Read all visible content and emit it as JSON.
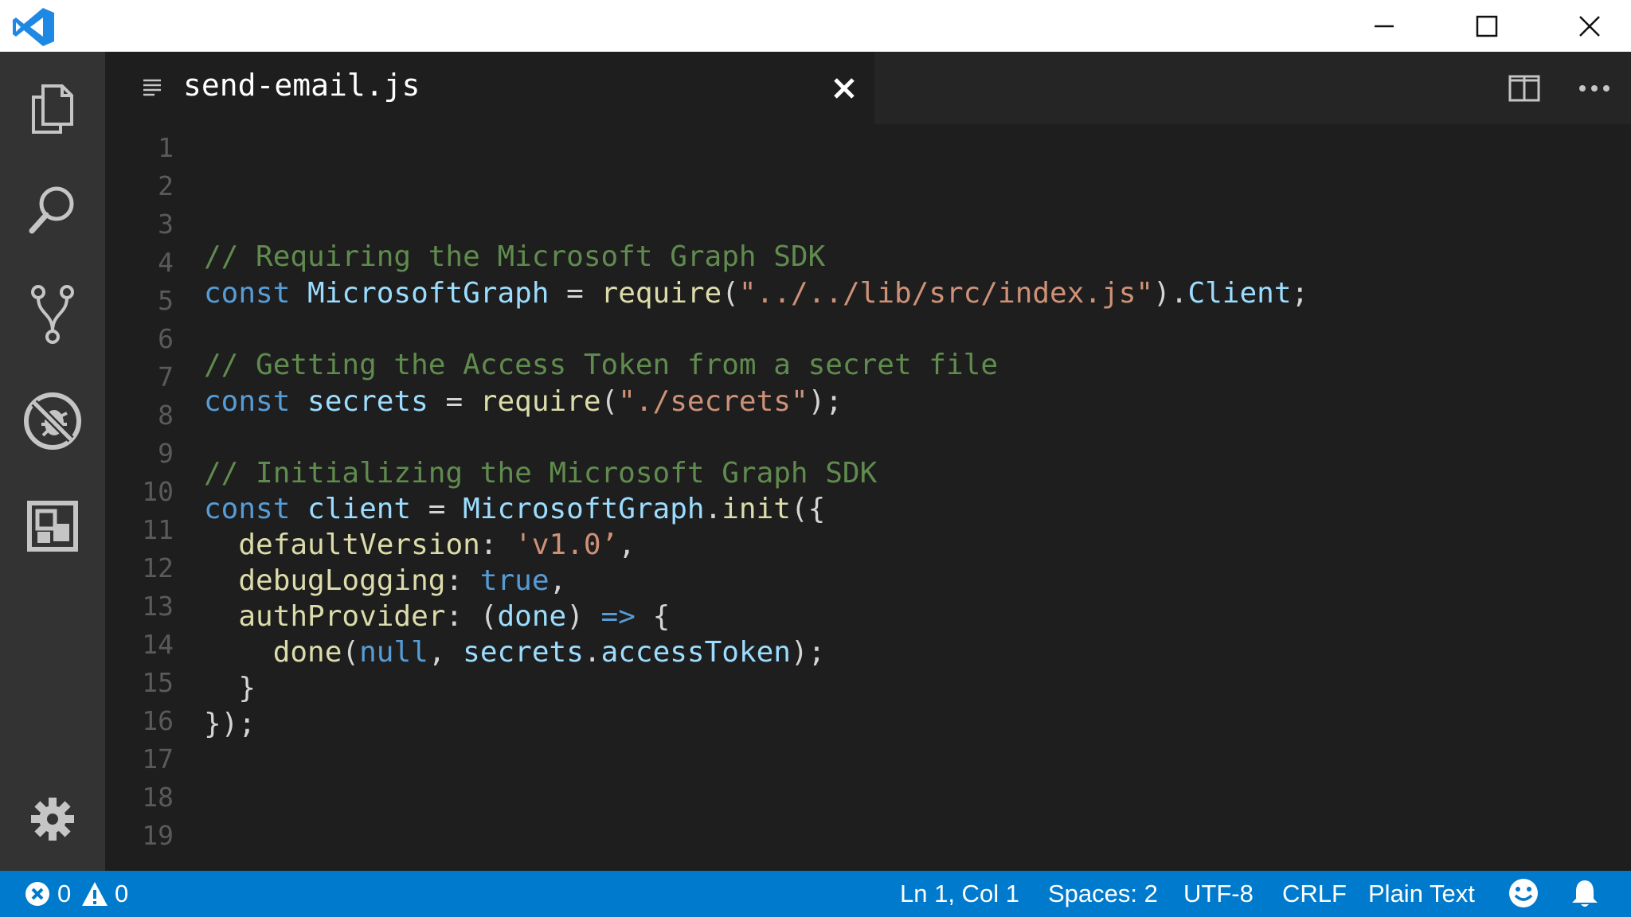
{
  "app": {
    "colors": {
      "status_bar": "#007acc",
      "activity_bar": "#333333",
      "editor_bg": "#1e1e1e",
      "title_bar": "#ffffff"
    }
  },
  "titlebar": {
    "icons": [
      "vscode-logo-icon",
      "minimize-icon",
      "maximize-icon",
      "close-icon"
    ]
  },
  "activity_bar": {
    "items": [
      {
        "name": "explorer",
        "icon": "files-icon"
      },
      {
        "name": "search",
        "icon": "search-icon"
      },
      {
        "name": "source-control",
        "icon": "git-branch-icon"
      },
      {
        "name": "debug",
        "icon": "no-bug-icon"
      },
      {
        "name": "extensions",
        "icon": "extensions-icon"
      }
    ],
    "settings_icon": "gear-icon"
  },
  "tab": {
    "title": "send-email.js",
    "icons": [
      "file-lines-icon",
      "close-icon",
      "split-editor-icon",
      "more-icon"
    ]
  },
  "editor": {
    "line_numbers": [
      "1",
      "2",
      "3",
      "4",
      "5",
      "6",
      "7",
      "8",
      "9",
      "10",
      "11",
      "12",
      "13",
      "14",
      "15",
      "16",
      "17",
      "18",
      "19"
    ],
    "lines": {
      "l4": {
        "t1": "// Requiring the Microsoft Graph SDK"
      },
      "l5": {
        "t1": "const",
        "t2": " MicrosoftGraph",
        "t3": " = ",
        "t4": "require",
        "t5": "(",
        "t6": "\"../../lib/src/index.js\"",
        "t7": ").",
        "t8": "Client",
        "t9": ";"
      },
      "l7": {
        "t1": "// Getting the Access Token from a secret file"
      },
      "l8": {
        "t1": "const",
        "t2": " secrets",
        "t3": " = ",
        "t4": "require",
        "t5": "(",
        "t6": "\"./secrets\"",
        "t7": ");"
      },
      "l10": {
        "t1": "// Initializing the Microsoft Graph SDK"
      },
      "l11": {
        "t1": "const",
        "t2": " client",
        "t3": " = ",
        "t4": "MicrosoftGraph",
        "t5": ".",
        "t6": "init",
        "t7": "({"
      },
      "l12": {
        "t1": "  ",
        "t2": "defaultVersion",
        "t3": ": ",
        "t4": "'v1.0’",
        "t5": ","
      },
      "l13": {
        "t1": "  ",
        "t2": "debugLogging",
        "t3": ": ",
        "t4": "true",
        "t5": ","
      },
      "l14": {
        "t1": "  ",
        "t2": "authProvider",
        "t3": ": (",
        "t4": "done",
        "t5": ") ",
        "t6": "=>",
        "t7": " {"
      },
      "l15": {
        "t1": "    ",
        "t2": "done",
        "t3": "(",
        "t4": "null",
        "t5": ", ",
        "t6": "secrets",
        "t7": ".",
        "t8": "accessToken",
        "t9": ");"
      },
      "l16": {
        "t1": "  }"
      },
      "l17": {
        "t1": "});"
      }
    }
  },
  "status_bar": {
    "errors": "0",
    "warnings": "0",
    "position": "Ln 1, Col 1",
    "indent": "Spaces: 2",
    "encoding": "UTF-8",
    "eol": "CRLF",
    "language": "Plain Text",
    "icons": [
      "error-icon",
      "warning-icon",
      "smiley-feedback-icon",
      "bell-icon"
    ]
  }
}
